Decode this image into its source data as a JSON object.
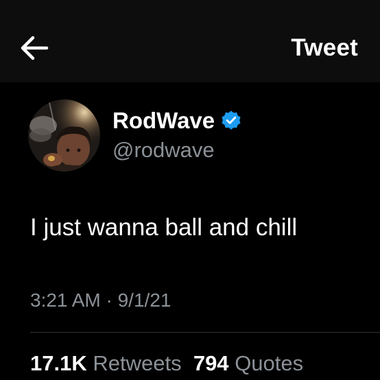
{
  "header": {
    "back_icon": "arrow-left-icon",
    "title": "Tweet"
  },
  "author": {
    "display_name": "RodWave",
    "handle": "@rodwave",
    "verified": true,
    "verified_icon": "verified-badge-icon",
    "verified_color": "#1d9bf0"
  },
  "tweet": {
    "text": "I just wanna ball and chill",
    "timestamp": "3:21 AM · 9/1/21"
  },
  "stats": {
    "retweets_count": "17.1K",
    "retweets_label": "Retweets",
    "quotes_count": "794",
    "quotes_label": "Quotes"
  },
  "colors": {
    "background": "#000000",
    "header_background": "#0d0d0d",
    "primary_text": "#ffffff",
    "secondary_text": "#8b9197",
    "divider": "#2f3336"
  }
}
